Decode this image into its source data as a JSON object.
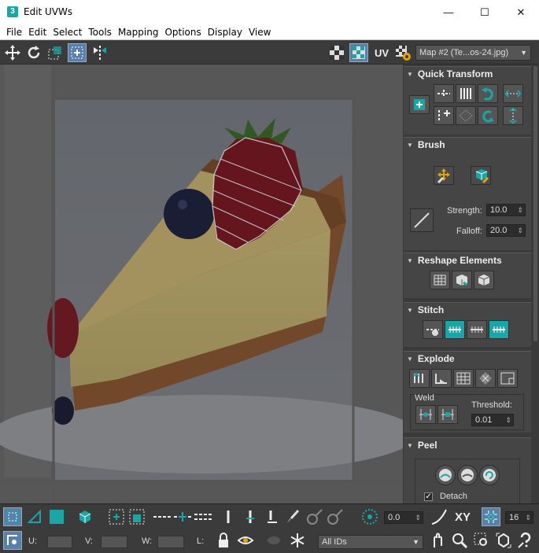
{
  "window": {
    "title": "Edit UVWs",
    "app_icon": "3",
    "minimize": "—",
    "maximize": "☐",
    "close": "✕"
  },
  "menu": [
    "File",
    "Edit",
    "Select",
    "Tools",
    "Mapping",
    "Options",
    "Display",
    "View"
  ],
  "toolbar": {
    "uv_label": "UV",
    "map_select": "Map #2 (Te...os-24.jpg)"
  },
  "panel": {
    "quick_transform": {
      "title": "Quick Transform"
    },
    "brush": {
      "title": "Brush",
      "strength_label": "Strength:",
      "strength_value": "10.0",
      "falloff_label": "Falloff:",
      "falloff_value": "20.0"
    },
    "reshape": {
      "title": "Reshape Elements"
    },
    "stitch": {
      "title": "Stitch"
    },
    "explode": {
      "title": "Explode",
      "weld_label": "Weld",
      "threshold_label": "Threshold:",
      "threshold_value": "0.01"
    },
    "peel": {
      "title": "Peel",
      "detach_label": "Detach",
      "detach_checked": true
    }
  },
  "status": {
    "spinner_value": "0.0",
    "xy_label": "XY",
    "grid_value": "16",
    "u_label": "U:",
    "v_label": "V:",
    "w_label": "W:",
    "l_label": "L:",
    "ids_select": "All IDs"
  },
  "colors": {
    "accent": "#1aa6a6",
    "panel_bg": "#454545",
    "dark": "#3b3b3b"
  }
}
